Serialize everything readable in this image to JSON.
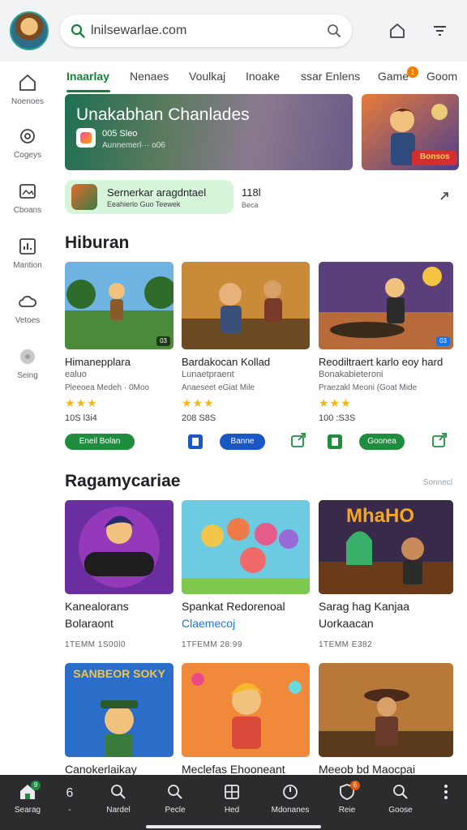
{
  "search": {
    "url": "lnilsewarlae.com"
  },
  "leftnav": [
    {
      "label": "Noenoes",
      "icon": "home-outline-icon"
    },
    {
      "label": "Cogeys",
      "icon": "gear-icon"
    },
    {
      "label": "Cboans",
      "icon": "image-icon"
    },
    {
      "label": "Mantion",
      "icon": "chart-icon"
    },
    {
      "label": "Vetoes",
      "icon": "cloud-icon"
    },
    {
      "label": "Seing",
      "icon": "disc-icon"
    }
  ],
  "tabs": [
    {
      "label": "Inaarlay",
      "active": true
    },
    {
      "label": "Nenaes"
    },
    {
      "label": "Voulkaj"
    },
    {
      "label": "Inoake"
    },
    {
      "label": "ssar Enlens"
    },
    {
      "label": "Game",
      "badge": "1"
    },
    {
      "label": "Goom"
    }
  ],
  "banner": {
    "title": "Unakabhan Chanlades",
    "sub1": "005 Slеo",
    "sub2": "Aunnemerl··· o06"
  },
  "promo": {
    "label": "Bonsos"
  },
  "featured": {
    "title": "Sernerkar aragdntael",
    "sub": "Eeahierlo Guo Teewek",
    "count": "118l",
    "count_sub": "Beca"
  },
  "section1": {
    "title": "Hiburan",
    "cards": [
      {
        "title": "Himanepplara",
        "sub": "ealuo",
        "meta": "Pleeoea Medeh · 0Moo",
        "stars": "★★★",
        "price": "10S l3i4",
        "chip": "Eneil Bolan",
        "badge": "03"
      },
      {
        "title": "Bardakocan Kollad",
        "sub": "Lunaetpraent",
        "meta": "Anaeseet eGiat Mile",
        "stars": "★★★",
        "price": "208 S8S",
        "chip": "Banne",
        "badge": ""
      },
      {
        "title": "Reodiltraert karlo eoy hard",
        "sub": "Bonakabieteroni",
        "meta": "Praezakl Meoni (Goat Mide",
        "stars": "★★★",
        "price": "100 :S3S",
        "chip": "Goonea",
        "badge": "03"
      }
    ]
  },
  "section2": {
    "title": "Ragamycariae",
    "more": "Sonnecl",
    "cards": [
      {
        "title": "Kanealorans",
        "sub": "Bolaraont",
        "meta": "1TEMM 1S00l0",
        "art": "controller-art"
      },
      {
        "title": "Spankat Redorenoal",
        "sub": "Claemecoj",
        "meta": "1TFEMM 28:99",
        "art": "characters-art",
        "sub_link": true
      },
      {
        "title": "Sarag hag Kanjaa",
        "sub": "Uorkaacan",
        "meta": "1TEMM E382",
        "art": "heroes-art",
        "logo": "MhaHO"
      }
    ]
  },
  "section3": {
    "cards": [
      {
        "title": "Canokerlaikay",
        "logo": "SANBEOR SOKY"
      },
      {
        "title": "Meclefas Ehooneant"
      },
      {
        "title": "Meeob bd Maocpai"
      }
    ]
  },
  "bottomnav": [
    {
      "label": "Searag",
      "icon": "home-icon",
      "badge": "9"
    },
    {
      "label": "-",
      "icon": "number-six-icon"
    },
    {
      "label": "Nardel",
      "icon": "search-icon"
    },
    {
      "label": "Pecle",
      "icon": "search-icon"
    },
    {
      "label": "Hed",
      "icon": "grid-icon"
    },
    {
      "label": "Mdonanes",
      "icon": "compass-icon"
    },
    {
      "label": "Reie",
      "icon": "shield-icon",
      "badge": "6"
    },
    {
      "label": "Goose",
      "icon": "search-icon"
    },
    {
      "label": "",
      "icon": "more-vertical-icon"
    }
  ],
  "colors": {
    "accent": "#188038",
    "chip_green": "#1e8e3e",
    "chip_blue": "#1a56c4",
    "bottom_bg": "#2b2c2e"
  }
}
